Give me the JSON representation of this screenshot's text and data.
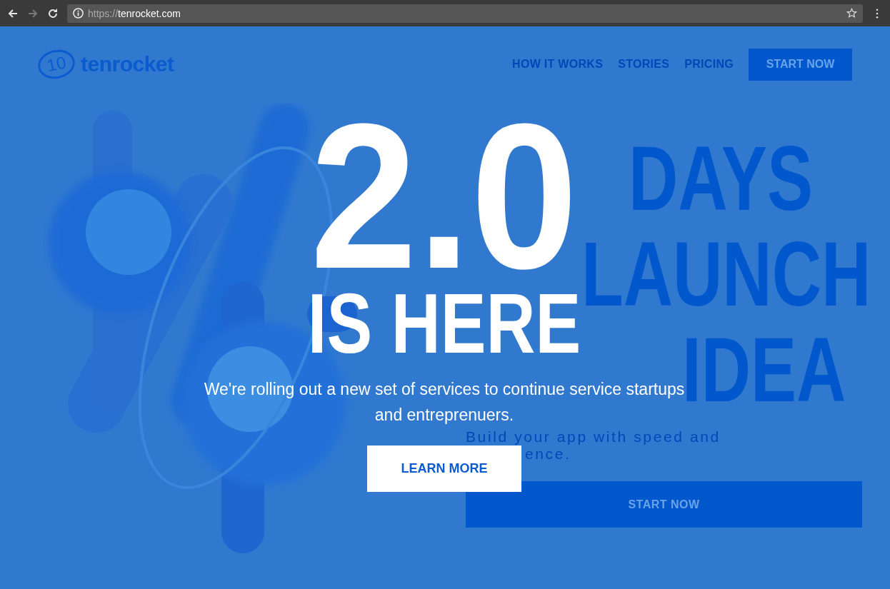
{
  "browser": {
    "nav_buttons": [
      {
        "kind": "back",
        "disabled": false
      },
      {
        "kind": "forward",
        "disabled": true
      },
      {
        "kind": "reload",
        "disabled": false
      }
    ],
    "url": {
      "scheme": "https://",
      "host": "tenrocket.com"
    }
  },
  "header": {
    "logo_mark": "10",
    "logo_text": "tenrocket",
    "nav": [
      "HOW IT WORKS",
      "STORIES",
      "PRICING"
    ],
    "cta": "START NOW"
  },
  "hero": {
    "headline": [
      "DAYS",
      "LAUNCH",
      "IDEA"
    ],
    "subtitle": [
      "Build your app with speed and",
      "ence."
    ],
    "cta": "START NOW"
  },
  "announcement": {
    "version": "2.0",
    "title": "IS HERE",
    "text": "We're rolling out a new set of services to continue service startups and entreprenuers.",
    "button": "LEARN MORE"
  }
}
